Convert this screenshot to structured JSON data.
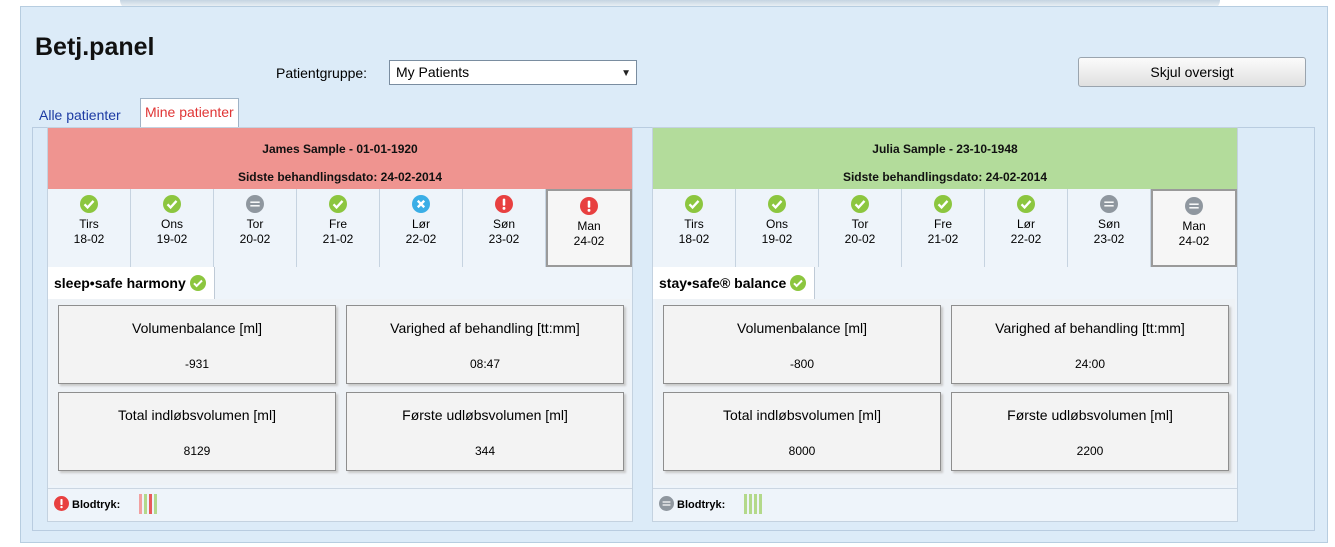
{
  "header": {
    "title": "Betj.panel",
    "group_label": "Patientgruppe:",
    "group_value": "My Patients",
    "hide_button": "Skjul oversigt"
  },
  "tabs": [
    {
      "label": "Alle patienter",
      "active": false
    },
    {
      "label": "Mine patienter",
      "active": true
    }
  ],
  "patients": [
    {
      "name_line": "James Sample - 01-01-1920",
      "last_treatment": "Sidste behandlingsdato: 24-02-2014",
      "header_color": "#ef9490",
      "days": [
        {
          "name": "Tirs",
          "date": "18-02",
          "status": "ok"
        },
        {
          "name": "Ons",
          "date": "19-02",
          "status": "ok"
        },
        {
          "name": "Tor",
          "date": "20-02",
          "status": "none"
        },
        {
          "name": "Fre",
          "date": "21-02",
          "status": "ok"
        },
        {
          "name": "Lør",
          "date": "22-02",
          "status": "cancel"
        },
        {
          "name": "Søn",
          "date": "23-02",
          "status": "alert"
        },
        {
          "name": "Man",
          "date": "24-02",
          "status": "alert"
        }
      ],
      "therapy": "sleep•safe harmony",
      "metrics": [
        {
          "label": "Volumenbalance [ml]",
          "value": "-931"
        },
        {
          "label": "Varighed af behandling [tt:mm]",
          "value": "08:47"
        },
        {
          "label": "Total indløbsvolumen [ml]",
          "value": "8129"
        },
        {
          "label": "Første udløbsvolumen [ml]",
          "value": "344"
        }
      ],
      "footer_label": "Blodtryk:",
      "footer_status": "alert"
    },
    {
      "name_line": "Julia Sample - 23-10-1948",
      "last_treatment": "Sidste behandlingsdato: 24-02-2014",
      "header_color": "#b3dc9b",
      "days": [
        {
          "name": "Tirs",
          "date": "18-02",
          "status": "ok"
        },
        {
          "name": "Ons",
          "date": "19-02",
          "status": "ok"
        },
        {
          "name": "Tor",
          "date": "20-02",
          "status": "ok"
        },
        {
          "name": "Fre",
          "date": "21-02",
          "status": "ok"
        },
        {
          "name": "Lør",
          "date": "22-02",
          "status": "ok"
        },
        {
          "name": "Søn",
          "date": "23-02",
          "status": "none"
        },
        {
          "name": "Man",
          "date": "24-02",
          "status": "none"
        }
      ],
      "therapy": "stay•safe® balance",
      "metrics": [
        {
          "label": "Volumenbalance [ml]",
          "value": "-800"
        },
        {
          "label": "Varighed af behandling [tt:mm]",
          "value": "24:00"
        },
        {
          "label": "Total indløbsvolumen [ml]",
          "value": "8000"
        },
        {
          "label": "Første udløbsvolumen [ml]",
          "value": "2200"
        }
      ],
      "footer_label": "Blodtryk:",
      "footer_status": "none"
    }
  ],
  "colors": {
    "ok": "#8cc63f",
    "none": "#8f979f",
    "cancel": "#3aaee6",
    "alert": "#e84040",
    "selected_tab": "#e03535"
  }
}
